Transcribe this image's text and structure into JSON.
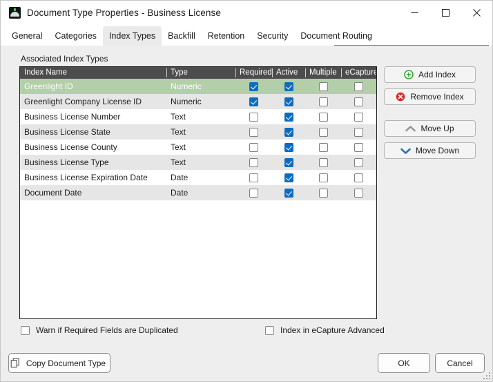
{
  "window": {
    "title": "Document Type Properties  - Business License",
    "app_icon": "document-type-icon",
    "controls": {
      "minimize": "minimize-icon",
      "maximize": "maximize-icon",
      "close": "close-icon"
    }
  },
  "tabs": [
    {
      "label": "General",
      "active": false
    },
    {
      "label": "Categories",
      "active": false
    },
    {
      "label": "Index Types",
      "active": true
    },
    {
      "label": "Backfill",
      "active": false
    },
    {
      "label": "Retention",
      "active": false
    },
    {
      "label": "Security",
      "active": false
    },
    {
      "label": "Document Routing",
      "active": false
    }
  ],
  "main": {
    "section_label": "Associated Index Types",
    "grid": {
      "columns": [
        "Index Name",
        "Type",
        "Required",
        "Active",
        "Multiple",
        "eCapture"
      ],
      "rows": [
        {
          "name": "Greenlight ID",
          "type": "Numeric",
          "required": true,
          "active": true,
          "multiple": false,
          "ecapture": false,
          "selected": true
        },
        {
          "name": "Greenlight Company License ID",
          "type": "Numeric",
          "required": true,
          "active": true,
          "multiple": false,
          "ecapture": false,
          "selected": false
        },
        {
          "name": "Business License Number",
          "type": "Text",
          "required": false,
          "active": true,
          "multiple": false,
          "ecapture": false,
          "selected": false
        },
        {
          "name": "Business License State",
          "type": "Text",
          "required": false,
          "active": true,
          "multiple": false,
          "ecapture": false,
          "selected": false
        },
        {
          "name": "Business License County",
          "type": "Text",
          "required": false,
          "active": true,
          "multiple": false,
          "ecapture": false,
          "selected": false
        },
        {
          "name": "Business License Type",
          "type": "Text",
          "required": false,
          "active": true,
          "multiple": false,
          "ecapture": false,
          "selected": false
        },
        {
          "name": "Business License Expiration Date",
          "type": "Date",
          "required": false,
          "active": true,
          "multiple": false,
          "ecapture": false,
          "selected": false
        },
        {
          "name": "Document Date",
          "type": "Date",
          "required": false,
          "active": true,
          "multiple": false,
          "ecapture": false,
          "selected": false
        }
      ]
    },
    "side_buttons": [
      {
        "label": "Add Index",
        "icon": "add-circle-icon"
      },
      {
        "label": "Remove Index",
        "icon": "remove-circle-icon"
      },
      {
        "label": "Move Up",
        "icon": "chevron-up-icon"
      },
      {
        "label": "Move Down",
        "icon": "chevron-down-icon"
      }
    ],
    "options": [
      {
        "label": "Warn if Required Fields are Duplicated",
        "checked": false
      },
      {
        "label": "Index in eCapture Advanced",
        "checked": false
      }
    ]
  },
  "footer": {
    "copy_label": "Copy Document Type",
    "copy_icon": "copy-icon",
    "ok_label": "OK",
    "cancel_label": "Cancel"
  },
  "colors": {
    "selected_row": "#b3cfa9",
    "checkbox_checked": "#0f6cbd",
    "header_bar": "#4c4c4c",
    "add_icon": "#3aa33a",
    "remove_icon": "#d72b2b",
    "move_down_icon": "#2f6fb5",
    "move_up_icon": "#9a9a9a"
  }
}
